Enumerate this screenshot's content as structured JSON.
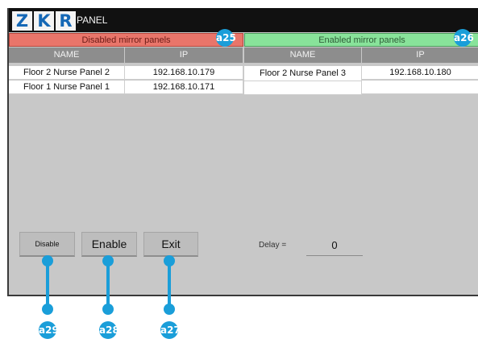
{
  "app": {
    "logo_letters": [
      "Z",
      "K",
      "R"
    ],
    "title": "PANEL"
  },
  "disabled_group": {
    "header": "Disabled mirror panels",
    "columns": [
      "NAME",
      "IP"
    ],
    "rows": [
      {
        "name": "Floor 2 Nurse Panel 2",
        "ip": "192.168.10.179"
      },
      {
        "name": "Floor 1 Nurse Panel 1",
        "ip": "192.168.10.171"
      }
    ]
  },
  "enabled_group": {
    "header": "Enabled mirror panels",
    "columns": [
      "NAME",
      "IP"
    ],
    "rows": [
      {
        "name": "Floor 2 Nurse Panel 3",
        "ip": "192.168.10.180"
      },
      {
        "name": "",
        "ip": ""
      }
    ]
  },
  "buttons": {
    "disable": "Disable",
    "enable": "Enable",
    "exit": "Exit"
  },
  "delay": {
    "label": "Delay =",
    "value": "0"
  },
  "callouts": {
    "a25": "a25",
    "a26": "a26",
    "a27": "a27",
    "a28": "a28",
    "a29": "a29"
  },
  "colors": {
    "disabled_header": "#e9756a",
    "enabled_header": "#88e39a",
    "column_header": "#8d8d8d",
    "callout": "#1a9ed9",
    "logo_blue": "#1568b6"
  }
}
